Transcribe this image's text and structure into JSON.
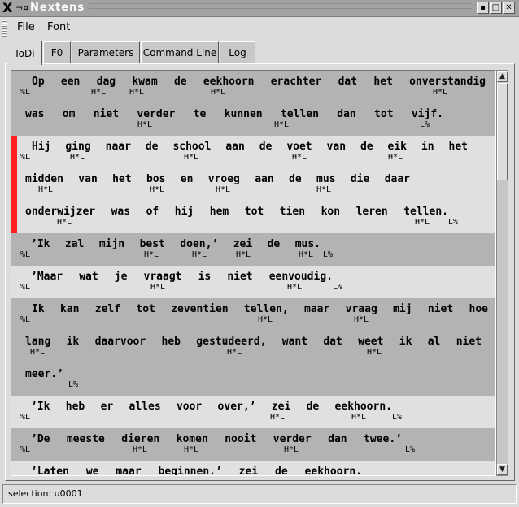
{
  "window": {
    "title": "Nextens"
  },
  "menu": {
    "file": "File",
    "font": "Font"
  },
  "tabs": [
    "ToDi",
    "F0",
    "Parameters",
    "Command Line",
    "Log"
  ],
  "status": "selection: u0001",
  "sentences": [
    {
      "words": [
        "Op",
        "een",
        "dag",
        "kwam",
        "de",
        "eekhoorn",
        "erachter",
        "dat",
        "het",
        "onverstandig"
      ],
      "tones": [
        "%L",
        "H*L",
        "H*L",
        "H*L",
        "H*L"
      ]
    },
    {
      "words": [
        "was",
        "om",
        "niet",
        "verder",
        "te",
        "kunnen",
        "tellen",
        "dan",
        "tot",
        "vijf."
      ],
      "tones": [
        "H*L",
        "H*L",
        "L%"
      ]
    },
    {
      "words": [
        "Hij",
        "ging",
        "naar",
        "de",
        "school",
        "aan",
        "de",
        "voet",
        "van",
        "de",
        "eik",
        "in",
        "het"
      ],
      "tones": [
        "%L",
        "H*L",
        "H*L",
        "H*L",
        "H*L"
      ]
    },
    {
      "words": [
        "midden",
        "van",
        "het",
        "bos",
        "en",
        "vroeg",
        "aan",
        "de",
        "mus",
        "die",
        "daar"
      ],
      "tones": [
        "H*L",
        "H*L",
        "H*L",
        "H*L"
      ]
    },
    {
      "words": [
        "onderwijzer",
        "was",
        "of",
        "hij",
        "hem",
        "tot",
        "tien",
        "kon",
        "leren",
        "tellen."
      ],
      "tones": [
        "H*L",
        "H*L",
        "L%"
      ]
    },
    {
      "words": [
        "’Ik",
        "zal",
        "mijn",
        "best",
        "doen,’",
        "zei",
        "de",
        "mus."
      ],
      "tones": [
        "%L",
        "H*L",
        "H*L",
        "H*L",
        "H*L",
        "L%"
      ]
    },
    {
      "words": [
        "’Maar",
        "wat",
        "je",
        "vraagt",
        "is",
        "niet",
        "eenvoudig."
      ],
      "tones": [
        "%L",
        "H*L",
        "H*L",
        "L%"
      ]
    },
    {
      "words": [
        "Ik",
        "kan",
        "zelf",
        "tot",
        "zeventien",
        "tellen,",
        "maar",
        "vraag",
        "mij",
        "niet",
        "hoe"
      ],
      "tones": [
        "%L",
        "H*L",
        "H*L"
      ]
    },
    {
      "words": [
        "lang",
        "ik",
        "daarvoor",
        "heb",
        "gestudeerd,",
        "want",
        "dat",
        "weet",
        "ik",
        "al",
        "niet"
      ],
      "tones": [
        "H*L",
        "H*L",
        "H*L"
      ]
    },
    {
      "words": [
        "meer.’"
      ],
      "tones": [
        "L%"
      ]
    },
    {
      "words": [
        "’Ik",
        "heb",
        "er",
        "alles",
        "voor",
        "over,’",
        "zei",
        "de",
        "eekhoorn."
      ],
      "tones": [
        "%L",
        "H*L",
        "H*L",
        "L%"
      ]
    },
    {
      "words": [
        "’De",
        "meeste",
        "dieren",
        "komen",
        "nooit",
        "verder",
        "dan",
        "twee.’"
      ],
      "tones": [
        "%L",
        "H*L",
        "H*L",
        "H*L",
        "L%"
      ]
    },
    {
      "words": [
        "’Laten",
        "we",
        "maar",
        "beginnen.’",
        "zei",
        "de",
        "eekhoorn."
      ],
      "tones": []
    }
  ]
}
